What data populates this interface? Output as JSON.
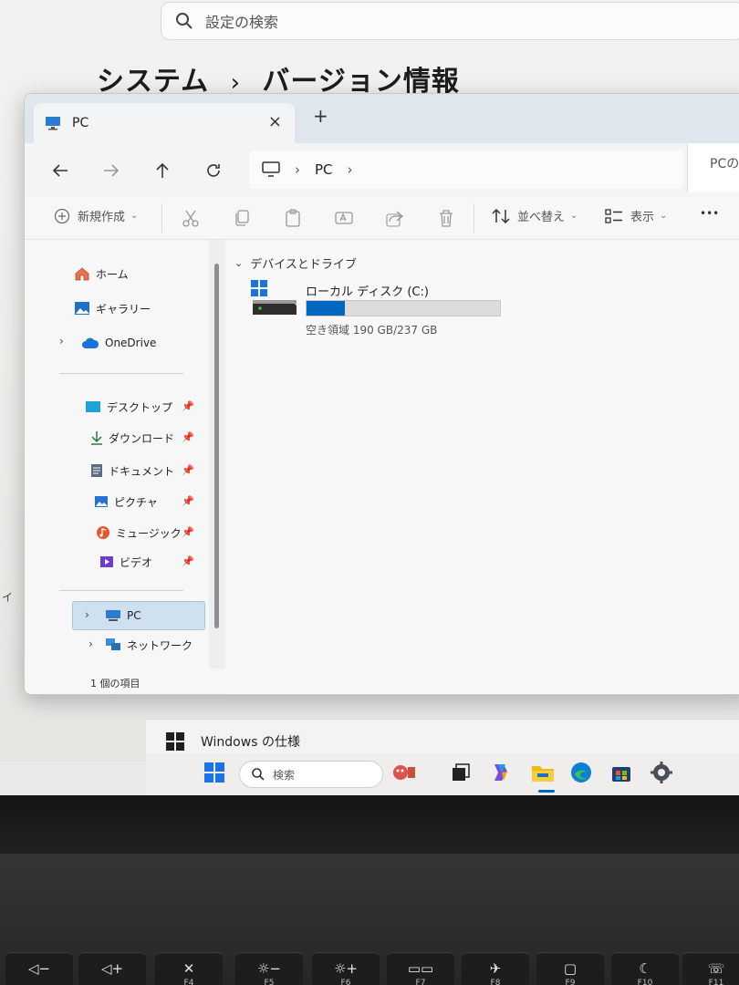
{
  "settings": {
    "search_placeholder": "設定の検索",
    "breadcrumb_parent": "システム",
    "breadcrumb_separator": "›",
    "breadcrumb_current": "バージョン情報",
    "windows_spec_label": "Windows の仕様",
    "edge_text": "イ"
  },
  "explorer": {
    "tab_title": "PC",
    "tab_close": "×",
    "new_tab": "+",
    "address_path": "PC",
    "address_chevron": "›",
    "search_partial": "PCの",
    "commands": {
      "new_label": "新規作成",
      "sort_label": "並べ替え",
      "view_label": "表示",
      "more": "•••"
    },
    "nav_pane": {
      "home": "ホーム",
      "gallery": "ギャラリー",
      "onedrive": "OneDrive",
      "desktop": "デスクトップ",
      "downloads": "ダウンロード",
      "documents": "ドキュメント",
      "pictures": "ピクチャ",
      "music": "ミュージック",
      "videos": "ビデオ",
      "pc": "PC",
      "network": "ネットワーク"
    },
    "group_header": "デバイスとドライブ",
    "drive": {
      "name": "ローカル ディスク (C:)",
      "free_text": "空き領域 190 GB/237 GB",
      "used_fraction": 0.2
    },
    "status_text": "1 個の項目"
  },
  "taskbar": {
    "search_label": "検索"
  },
  "keyboard": {
    "keys": [
      {
        "glyph": "◁−",
        "label": ""
      },
      {
        "glyph": "◁+",
        "label": ""
      },
      {
        "glyph": "✕",
        "label": "F4"
      },
      {
        "glyph": "☼−",
        "label": "F5"
      },
      {
        "glyph": "☼+",
        "label": "F6"
      },
      {
        "glyph": "▭▭",
        "label": "F7"
      },
      {
        "glyph": "✈",
        "label": "F8"
      },
      {
        "glyph": "▢",
        "label": "F9"
      },
      {
        "glyph": "☾",
        "label": "F10"
      },
      {
        "glyph": "☏",
        "label": "F11"
      }
    ]
  },
  "colors": {
    "accent": "#0067c0",
    "selection": "#cfe1f0"
  }
}
